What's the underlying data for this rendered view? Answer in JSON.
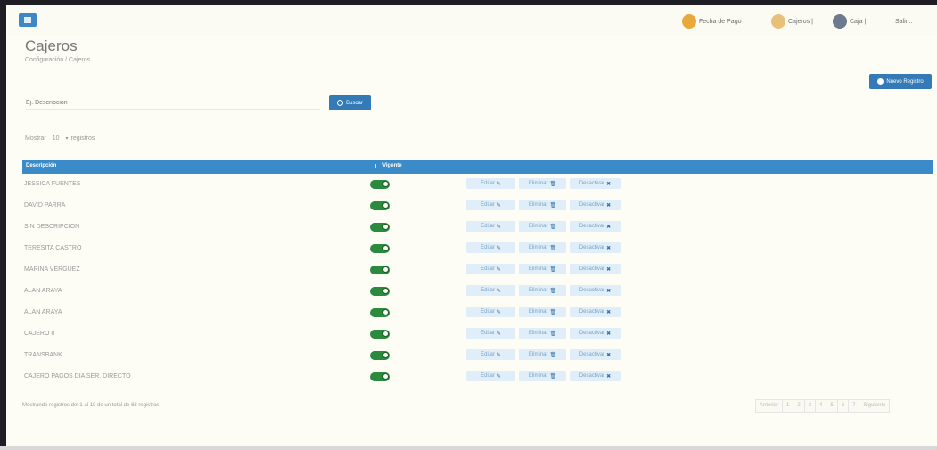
{
  "topbar": {
    "items": [
      {
        "label": "Fecha de Pago |",
        "icon": "coin-icon",
        "color": "#e8a93c"
      },
      {
        "label": "Cajeros |",
        "icon": "user-icon",
        "color": "#e8c07a"
      },
      {
        "label": "Caja |",
        "icon": "register-icon",
        "color": "#6b7a8c"
      },
      {
        "label": "Salir..."
      }
    ]
  },
  "page": {
    "title": "Cajeros",
    "breadcrumb": "Configuración / Cajeros",
    "new_button": "Nuevo Registro"
  },
  "search": {
    "placeholder": "Ej. Descripción",
    "button": "Buscar"
  },
  "entries": {
    "prefix": "Mostrar",
    "value": "10",
    "suffix": "registros"
  },
  "table": {
    "headers": [
      "Descripción",
      "Vigente"
    ],
    "actions": [
      "Editar",
      "Eliminar",
      "Desactivar"
    ],
    "rows": [
      {
        "name": "JESSICA FUENTES",
        "active": true
      },
      {
        "name": "DAVID PARRA",
        "active": true
      },
      {
        "name": "SIN DESCRIPCION",
        "active": true
      },
      {
        "name": "TERESITA CASTRO",
        "active": true
      },
      {
        "name": "MARINA VERGUEZ",
        "active": true
      },
      {
        "name": "ALAN ARAYA",
        "active": true
      },
      {
        "name": "ALAN ARAYA",
        "active": true
      },
      {
        "name": "CAJERO 8",
        "active": true
      },
      {
        "name": "TRANSBANK",
        "active": true
      },
      {
        "name": "CAJERO PAGOS DIA SER. DIRECTO",
        "active": true
      }
    ]
  },
  "footer": {
    "info": "Mostrando registros del 1 al 10 de un total de 68 registros",
    "pager": [
      "Anterior",
      "1",
      "2",
      "3",
      "4",
      "5",
      "6",
      "7",
      "Siguiente"
    ]
  },
  "colors": {
    "accent": "#337ab7",
    "table_header": "#3a8bc8",
    "toggle_on": "#2b8a3e",
    "action_bg": "#dfeef8"
  }
}
